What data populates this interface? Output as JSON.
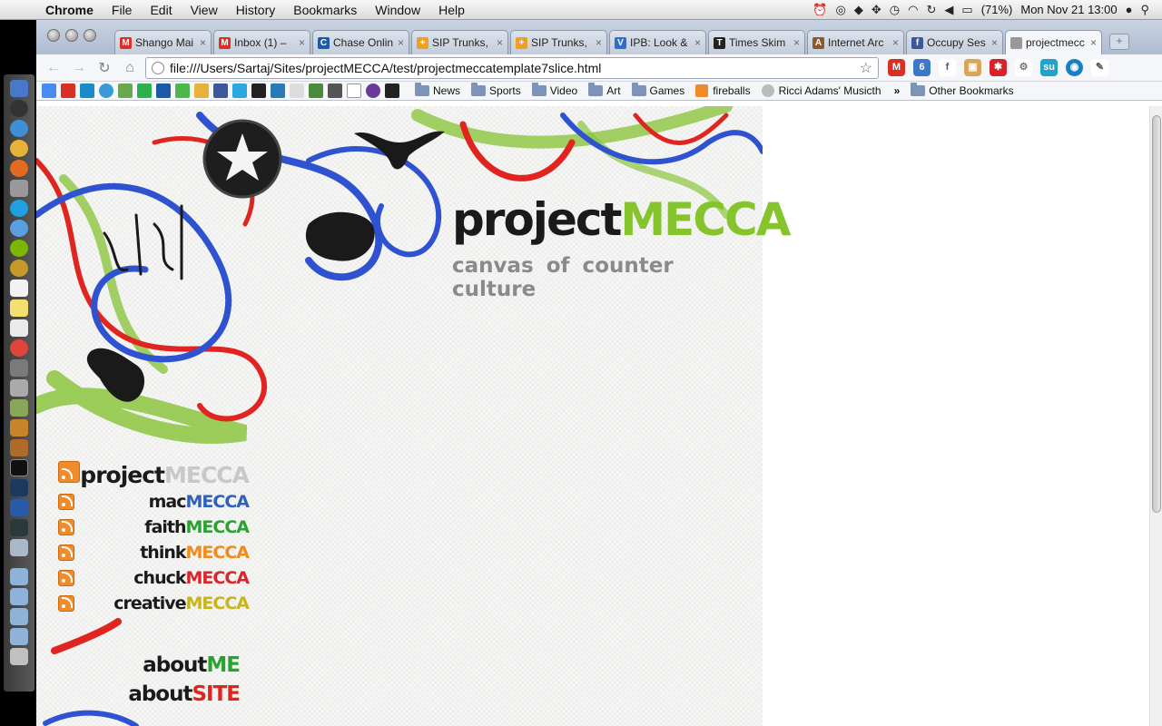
{
  "menubar": {
    "app": "Chrome",
    "items": [
      "File",
      "Edit",
      "View",
      "History",
      "Bookmarks",
      "Window",
      "Help"
    ],
    "battery": "(71%)",
    "clock": "Mon Nov 21  13:00"
  },
  "tabs": [
    {
      "title": "Shango Mai",
      "icon": "gmail-icon",
      "color": "#d93025",
      "glyph": "M"
    },
    {
      "title": "Inbox (1) –",
      "icon": "gmail-icon",
      "color": "#d93025",
      "glyph": "M"
    },
    {
      "title": "Chase Onlin",
      "icon": "chase-icon",
      "color": "#1a5aa8",
      "glyph": "C"
    },
    {
      "title": "SIP Trunks,",
      "icon": "plus-icon",
      "color": "#f0a020",
      "glyph": "+"
    },
    {
      "title": "SIP Trunks,",
      "icon": "plus-icon",
      "color": "#f0a020",
      "glyph": "+"
    },
    {
      "title": "IPB: Look &",
      "icon": "ipb-icon",
      "color": "#2a6fc9",
      "glyph": "V"
    },
    {
      "title": "Times Skim",
      "icon": "nyt-icon",
      "color": "#222222",
      "glyph": "T"
    },
    {
      "title": "Internet Arc",
      "icon": "archive-icon",
      "color": "#8b5a2b",
      "glyph": "A"
    },
    {
      "title": "Occupy Ses",
      "icon": "facebook-icon",
      "color": "#3b5998",
      "glyph": "f"
    },
    {
      "title": "projectmecc",
      "icon": "page-icon",
      "color": "#999999",
      "glyph": "",
      "active": true
    }
  ],
  "omnibox": {
    "url": "file:///Users/Sartaj/Sites/projectMECCA/test/projectmeccatemplate7slice.html"
  },
  "bookmarks": {
    "folders": [
      "News",
      "Sports",
      "Video",
      "Art",
      "Games"
    ],
    "links": [
      "fireballs",
      "Ricci Adams' Musicth"
    ],
    "other": "Other Bookmarks"
  },
  "page": {
    "logo_a": "project",
    "logo_b": "MECCA",
    "tagline": "canvas of counter culture",
    "feeds": [
      {
        "a": "project",
        "b": "MECCA",
        "color": "#c8c8c8",
        "big": true
      },
      {
        "a": "mac",
        "b": "MECCA",
        "color": "#2f62b8"
      },
      {
        "a": "faith",
        "b": "MECCA",
        "color": "#2aa233"
      },
      {
        "a": "think",
        "b": "MECCA",
        "color": "#f08b1c"
      },
      {
        "a": "chuck",
        "b": "MECCA",
        "color": "#d9262c"
      },
      {
        "a": "creative",
        "b": "MECCA",
        "color": "#c9b41b"
      }
    ],
    "about_me_a": "about",
    "about_me_b": "ME",
    "about_site_a": "about",
    "about_site_b": "SITE"
  },
  "colors": {
    "swirl_red": "#e02420",
    "swirl_blue": "#2f52d0",
    "swirl_green": "#8cc63f",
    "about_me": "#2aa233",
    "about_site": "#e02420"
  }
}
